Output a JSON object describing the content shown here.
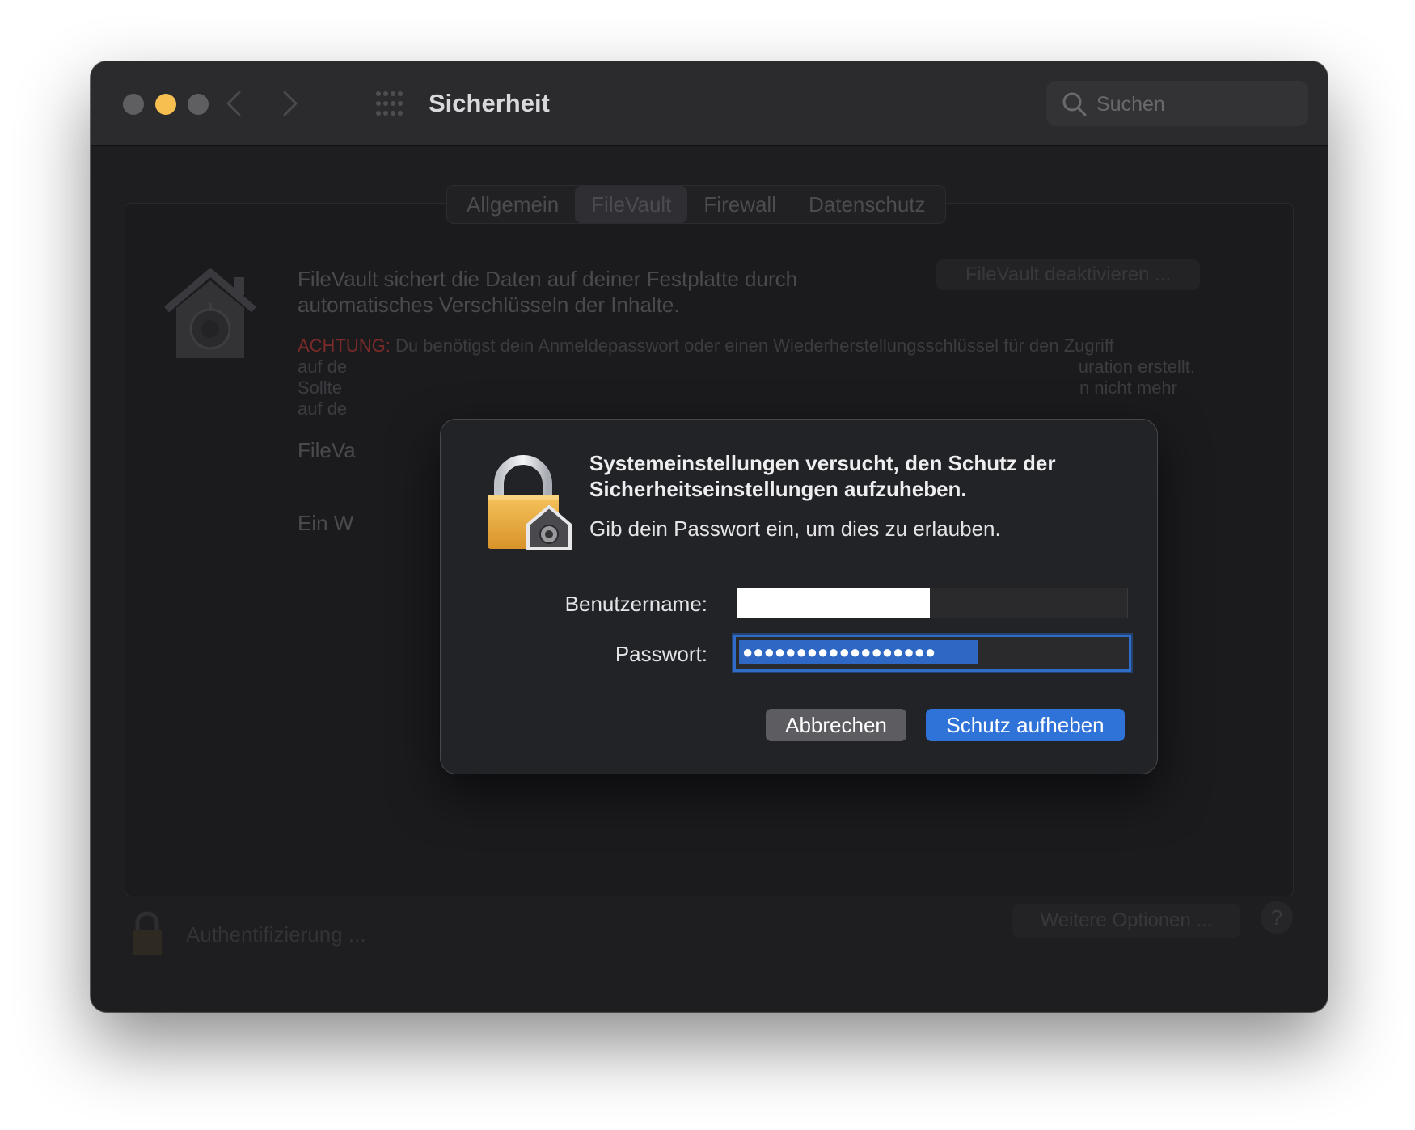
{
  "window": {
    "title": "Sicherheit",
    "search_placeholder": "Suchen"
  },
  "tabs": [
    {
      "label": "Allgemein"
    },
    {
      "label": "FileVault"
    },
    {
      "label": "Firewall"
    },
    {
      "label": "Datenschutz"
    }
  ],
  "background": {
    "description": "FileVault sichert die Daten auf deiner Festplatte durch automatisches Verschlüsseln der Inhalte.",
    "disable_button": "FileVault deaktivieren ...",
    "warning_prefix": "ACHTUNG:",
    "warning_line1": "Du benötigst dein Anmeldepasswort oder einen Wiederherstellungsschlüssel für den Zugriff",
    "warning_line2_start": "auf de",
    "warning_line2_end": "uration erstellt.",
    "warning_line3_start": "Sollte",
    "warning_line3_end": "n nicht mehr",
    "warning_line4_start": "auf de",
    "status_line": "FileVa",
    "key_line": "Ein W",
    "auth_text": "Authentifizierung ...",
    "more_options": "Weitere Optionen ...",
    "help": "?"
  },
  "dialog": {
    "title": "Systemeinstellungen versucht, den Schutz der Sicherheitseinstellungen aufzuheben.",
    "subtitle": "Gib dein Passwort ein, um dies zu erlauben.",
    "username_label": "Benutzername:",
    "password_label": "Passwort:",
    "password_value": "●●●●●●●●●●●●●●●●●●",
    "cancel_button": "Abbrechen",
    "confirm_button": "Schutz aufheben"
  },
  "colors": {
    "accent": "#2f72d8",
    "warning": "#e0443e",
    "minimize": "#f6bf4f",
    "lock_gold": "#e8a93a"
  }
}
